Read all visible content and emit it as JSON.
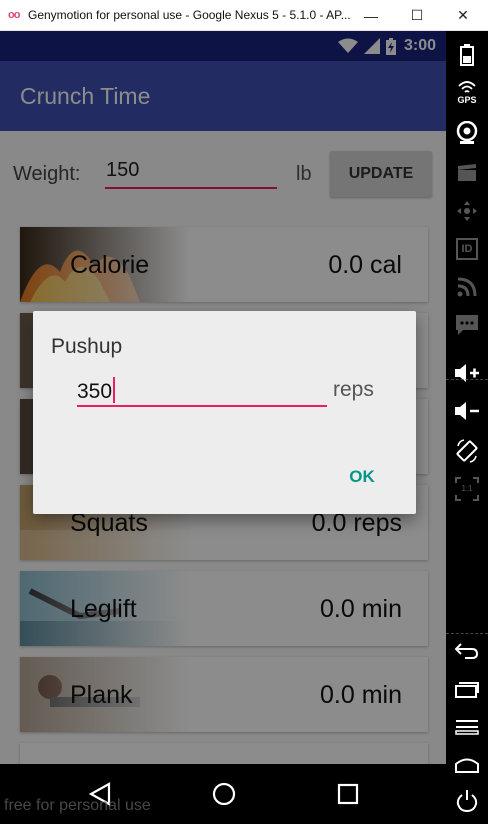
{
  "window": {
    "title": "Genymotion for personal use - Google Nexus 5 - 5.1.0 - AP...",
    "logo": "oo",
    "minimize_glyph": "—",
    "maximize_glyph": "☐",
    "close_glyph": "✕"
  },
  "statusbar": {
    "time": "3:00"
  },
  "app": {
    "title": "Crunch Time"
  },
  "weight": {
    "label": "Weight:",
    "value": "150",
    "unit": "lb",
    "update_label": "UPDATE"
  },
  "cards": [
    {
      "name": "Calorie",
      "value": "0.0 cal"
    },
    {
      "name": "Squats",
      "value": "0.0 reps"
    },
    {
      "name": "Leglift",
      "value": "0.0 min"
    },
    {
      "name": "Plank",
      "value": "0.0 min"
    }
  ],
  "dialog": {
    "title": "Pushup",
    "value": "350",
    "unit": "reps",
    "ok_label": "OK"
  },
  "watermark": "free for personal use",
  "colors": {
    "primary": "#3f51b5",
    "primary_dark": "#1a237e",
    "accent": "#e91e63",
    "ok": "#009688"
  },
  "side_toolbar": {
    "gps_label": "GPS",
    "id_label": "ID",
    "scale_label": "1:1"
  }
}
